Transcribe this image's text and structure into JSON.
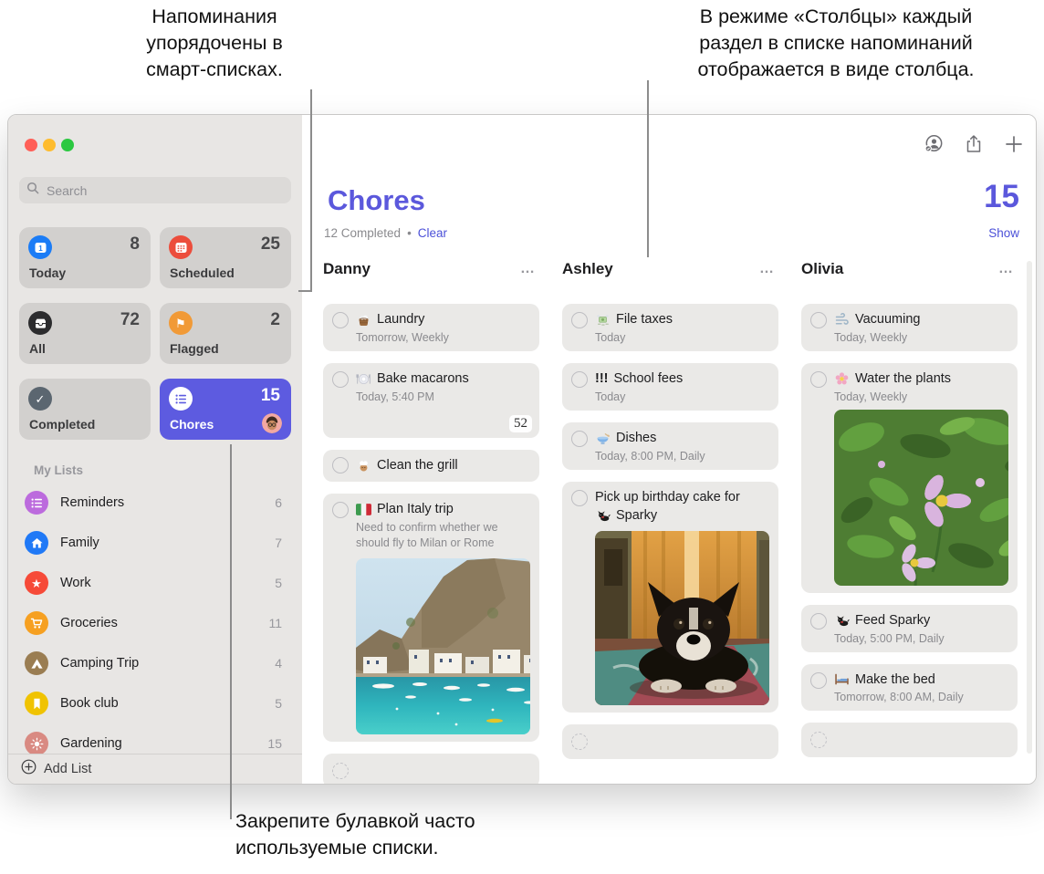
{
  "annotations": {
    "top_left_lines": [
      "Напоминания",
      "упорядочены в",
      "смарт-списках."
    ],
    "top_right_lines": [
      "В режиме «Столбцы» каждый",
      "раздел в списке напоминаний",
      "отображается в виде столбца."
    ],
    "bottom_lines": [
      "Закрепите булавкой часто",
      "используемые списки."
    ]
  },
  "colors": {
    "accent_purple": "#5d5be0",
    "link_purple": "#4b50d8",
    "today_blue": "#1b7cf6",
    "scheduled_red": "#ec4d3c",
    "all_black": "#2c2c2e",
    "flagged_orange": "#f19a37",
    "completed_gray": "#5b6670",
    "reminders_purple": "#bc6bdd",
    "family_blue": "#2079f6",
    "work_red": "#f64a38",
    "groceries_orange": "#f6a021",
    "camping_brown": "#9a7d52",
    "bookclub_yellow": "#f0c302",
    "gardening_rose": "#d98a82"
  },
  "window": {
    "sidebar": {
      "search_placeholder": "Search",
      "smart_lists": [
        {
          "label": "Today",
          "count": "8"
        },
        {
          "label": "Scheduled",
          "count": "25"
        },
        {
          "label": "All",
          "count": "72"
        },
        {
          "label": "Flagged",
          "count": "2"
        },
        {
          "label": "Completed",
          "count": ""
        },
        {
          "label": "Chores",
          "count": "15"
        }
      ],
      "my_lists_header": "My Lists",
      "my_lists": [
        {
          "label": "Reminders",
          "count": "6"
        },
        {
          "label": "Family",
          "count": "7"
        },
        {
          "label": "Work",
          "count": "5"
        },
        {
          "label": "Groceries",
          "count": "11"
        },
        {
          "label": "Camping Trip",
          "count": "4"
        },
        {
          "label": "Book club",
          "count": "5"
        },
        {
          "label": "Gardening",
          "count": "15"
        }
      ],
      "add_list_label": "Add List"
    },
    "content": {
      "title": "Chores",
      "completed_summary": "12 Completed",
      "bullet": "•",
      "clear_label": "Clear",
      "total_count": "15",
      "show_label": "Show",
      "more_label": "…",
      "columns": [
        {
          "name": "Danny",
          "tasks": [
            {
              "emoji": "🧺",
              "title": "Laundry",
              "detail": "Tomorrow, Weekly"
            },
            {
              "emoji": "🍽️",
              "title": "Bake macarons",
              "detail": "Today, 5:40 PM",
              "badge": "52"
            },
            {
              "emoji": "🧑🏽‍🍳",
              "title": "Clean the grill"
            },
            {
              "emoji": "🇮🇹",
              "title": "Plan Italy trip",
              "note": "Need to confirm whether we should fly to Milan or Rome",
              "photo": "italy-coast"
            }
          ]
        },
        {
          "name": "Ashley",
          "tasks": [
            {
              "emoji": "💸",
              "title": "File taxes",
              "detail": "Today"
            },
            {
              "priority": "!!!",
              "title": "School fees",
              "detail": "Today"
            },
            {
              "emoji": "🥣",
              "title": "Dishes",
              "detail": "Today, 8:00 PM, Daily"
            },
            {
              "title_line1": "Pick up birthday cake for",
              "emoji": "🐕",
              "title_line2": "Sparky",
              "photo": "dog"
            }
          ]
        },
        {
          "name": "Olivia",
          "tasks": [
            {
              "emoji": "💨",
              "title": "Vacuuming",
              "detail": "Today, Weekly"
            },
            {
              "emoji": "🌸",
              "title": "Water the plants",
              "detail": "Today, Weekly",
              "photo": "flowers"
            },
            {
              "emoji": "🐕",
              "title": "Feed Sparky",
              "detail": "Today, 5:00 PM, Daily"
            },
            {
              "emoji": "🛏️",
              "title": "Make the bed",
              "detail": "Tomorrow, 8:00 AM, Daily"
            }
          ]
        }
      ]
    }
  }
}
